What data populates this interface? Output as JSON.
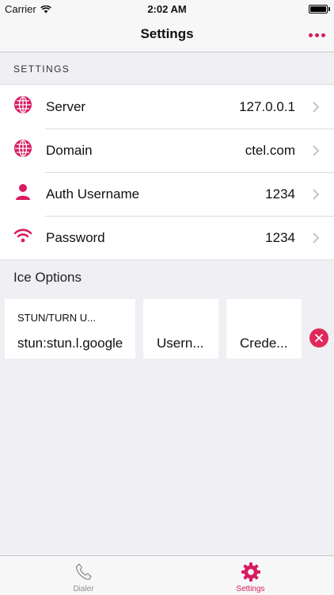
{
  "status_bar": {
    "carrier": "Carrier",
    "time": "2:02 AM"
  },
  "nav": {
    "title": "Settings"
  },
  "section_header": "SETTINGS",
  "settings_rows": [
    {
      "label": "Server",
      "value": "127.0.0.1",
      "icon": "globe-icon"
    },
    {
      "label": "Domain",
      "value": "ctel.com",
      "icon": "globe-icon"
    },
    {
      "label": "Auth Username",
      "value": "1234",
      "icon": "person-icon"
    },
    {
      "label": "Password",
      "value": "1234",
      "icon": "wifi-icon"
    }
  ],
  "ice": {
    "header": "Ice Options",
    "url_label": "STUN/TURN U...",
    "url_value": "stun:stun.l.google",
    "username": "Usern...",
    "credential": "Crede..."
  },
  "tabs": [
    {
      "label": "Dialer",
      "icon": "phone-icon",
      "active": false
    },
    {
      "label": "Settings",
      "icon": "gear-icon",
      "active": true
    }
  ],
  "colors": {
    "accent": "#d81b60",
    "inactive": "#8e8e93",
    "background": "#efeff4"
  }
}
